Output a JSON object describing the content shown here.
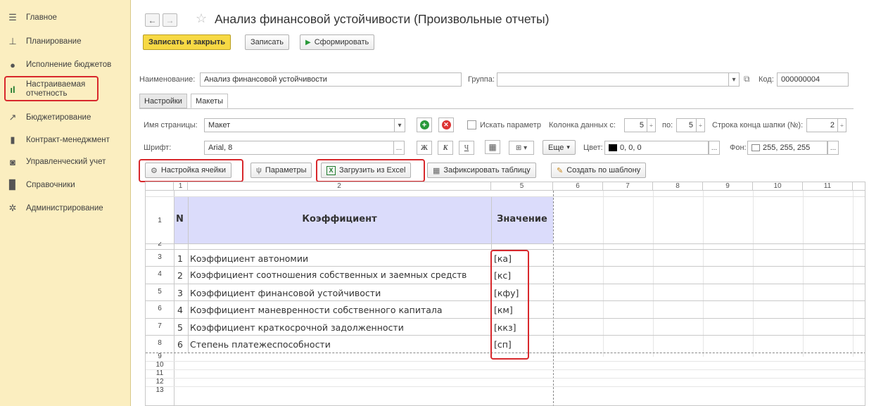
{
  "sidebar": {
    "items": [
      {
        "label": "Главное",
        "icon": "menu-icon"
      },
      {
        "label": "Планирование",
        "icon": "planning-icon"
      },
      {
        "label": "Исполнение бюджетов",
        "icon": "budget-execution-icon"
      },
      {
        "label": "Настраиваемая отчетность",
        "icon": "report-icon",
        "active": true
      },
      {
        "label": "Бюджетирование",
        "icon": "trend-icon"
      },
      {
        "label": "Контракт-менеджмент",
        "icon": "contract-icon"
      },
      {
        "label": "Управленческий учет",
        "icon": "accounting-icon"
      },
      {
        "label": "Справочники",
        "icon": "reference-icon"
      },
      {
        "label": "Администрирование",
        "icon": "gear-icon"
      }
    ]
  },
  "header": {
    "title": "Анализ финансовой устойчивости (Произвольные отчеты)"
  },
  "toolbar": {
    "save_close": "Записать и закрыть",
    "save": "Записать",
    "generate": "Сформировать"
  },
  "form": {
    "name_label": "Наименование:",
    "name_value": "Анализ финансовой устойчивости",
    "group_label": "Группа:",
    "group_value": "",
    "code_label": "Код:",
    "code_value": "000000004"
  },
  "tabs": [
    "Настройки",
    "Макеты"
  ],
  "page_settings": {
    "page_name_label": "Имя страницы:",
    "page_name_value": "Макет",
    "search_param_label": "Искать параметр",
    "data_col_label": "Колонка данных с:",
    "data_col_from": "5",
    "to_label": "по:",
    "data_col_to": "5",
    "header_end_label": "Строка конца шапки (№):",
    "header_end_value": "2"
  },
  "font_row": {
    "font_label": "Шрифт:",
    "font_value": "Arial, 8",
    "bold": "Ж",
    "italic": "К",
    "underline": "Ч",
    "more": "Еще",
    "color_label": "Цвет:",
    "color_value": "0, 0, 0",
    "bg_label": "Фон:",
    "bg_value": "255, 255, 255"
  },
  "actions": {
    "cell_settings": "Настройка ячейки",
    "parameters": "Параметры",
    "load_excel": "Загрузить из Excel",
    "fix_table": "Зафиксировать таблицу",
    "create_template": "Создать по шаблону"
  },
  "grid": {
    "col_headers": [
      "1",
      "2",
      "5",
      "6",
      "7",
      "8",
      "9",
      "10",
      "11"
    ],
    "row_numbers": [
      "1",
      "2",
      "3",
      "4",
      "5",
      "6",
      "7",
      "8",
      "9",
      "10",
      "11",
      "12",
      "13"
    ],
    "header_n": "N",
    "header_coef": "Коэффициент",
    "header_value": "Значение",
    "rows": [
      {
        "n": "1",
        "name": "Коэффициент автономии",
        "value": "[ка]"
      },
      {
        "n": "2",
        "name": "Коэффициент соотношения собственных и заемных средств",
        "value": "[кс]"
      },
      {
        "n": "3",
        "name": "Коэффициент финансовой устойчивости",
        "value": "[кфу]"
      },
      {
        "n": "4",
        "name": "Коэффициент маневренности собственного капитала",
        "value": "[км]"
      },
      {
        "n": "5",
        "name": "Коэффициент краткосрочной задолженности",
        "value": "[ккз]"
      },
      {
        "n": "6",
        "name": "Степень платежеспособности",
        "value": "[сп]"
      }
    ]
  },
  "colors": {
    "sidebar_bg": "#fbeec0",
    "primary_button": "#f7d944",
    "header_fill": "#dbdcfb",
    "highlight_red": "#d8282c"
  }
}
